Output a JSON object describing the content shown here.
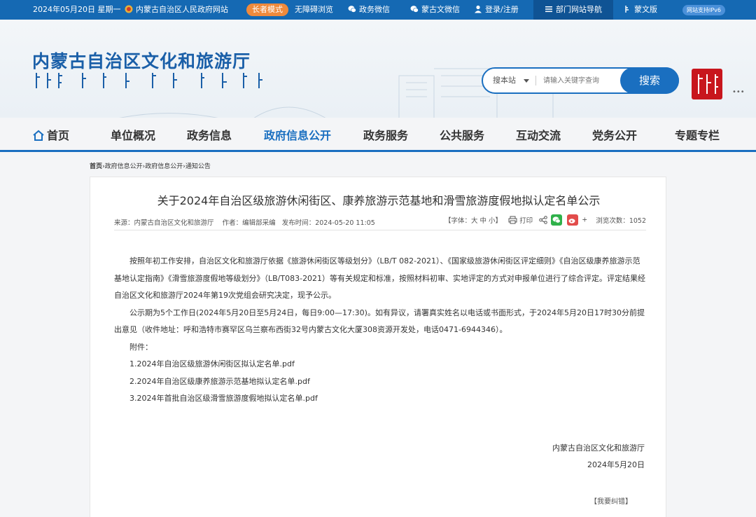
{
  "topbar": {
    "date": "2024年05月20日 星期一",
    "gov_site": "内蒙古自治区人民政府网站",
    "elder_mode": "长者模式",
    "accessible": "无障碍浏览",
    "weibo": "政务微信",
    "mongol_wechat": "蒙古文微信",
    "login": "登录/注册",
    "dept_nav": "部门网站导航",
    "mongol_version": "蒙文版",
    "ipv6": "网站支持IPv6"
  },
  "header": {
    "title": "内蒙古自治区文化和旅游厅",
    "search_scope": "搜本站",
    "search_placeholder": "请输入关键字查询",
    "search_button": "搜索",
    "share_icon": "share-dots-icon"
  },
  "nav": {
    "items": [
      "首页",
      "单位概况",
      "政务信息",
      "政府信息公开",
      "政务服务",
      "公共服务",
      "互动交流",
      "党务公开",
      "专题专栏"
    ],
    "active_index": 3,
    "accent": "#1a6fc0"
  },
  "breadcrumb": {
    "home": "首页",
    "c1": "›政府信息公开",
    "c2": "›政府信息公开",
    "c3": "›通知公告"
  },
  "article": {
    "title": "关于2024年自治区级旅游休闲街区、康养旅游示范基地和滑雪旅游度假地拟认定名单公示",
    "meta_source": "来源：内蒙古自治区文化和旅游厅",
    "meta_author": "作者：编辑部采编",
    "meta_time": "发布时间：2024-05-20 11:05",
    "font_label": "【字体：大 中 小】",
    "print": "打印",
    "plus": "+",
    "views": "浏览次数：1052",
    "p1": "按照年初工作安排，自治区文化和旅游厅依据《旅游休闲街区等级划分》（LB/T 082-2021）、《国家级旅游休闲街区评定细则》《自治区级康养旅游示范基地认定指南》《滑雪旅游度假地等级划分》（LB/T083-2021）等有关规定和标准，按照材料初审、实地评定的方式对申报单位进行了综合评定。评定结果经自治区文化和旅游厅2024年第19次党组会研究决定，现予公示。",
    "p2": "公示期为5个工作日(2024年5月20日至5月24日，每日9:00—17:30)。如有异议，请署真实姓名以电话或书面形式，于2024年5月20日17时30分前提出意见（收件地址：呼和浩特市赛罕区乌兰察布西街32号内蒙古文化大厦308资源开发处，电话0471-6944346）。",
    "att_label": "附件：",
    "attachments": [
      "1.2024年自治区级旅游休闲街区拟认定名单.pdf",
      "2.2024年自治区级康养旅游示范基地拟认定名单.pdf",
      "3.2024年首批自治区级滑雪旅游度假地拟认定名单.pdf"
    ],
    "sign_org": "内蒙古自治区文化和旅游厅",
    "sign_date": "2024年5月20日",
    "fix": "【我要纠错】"
  }
}
